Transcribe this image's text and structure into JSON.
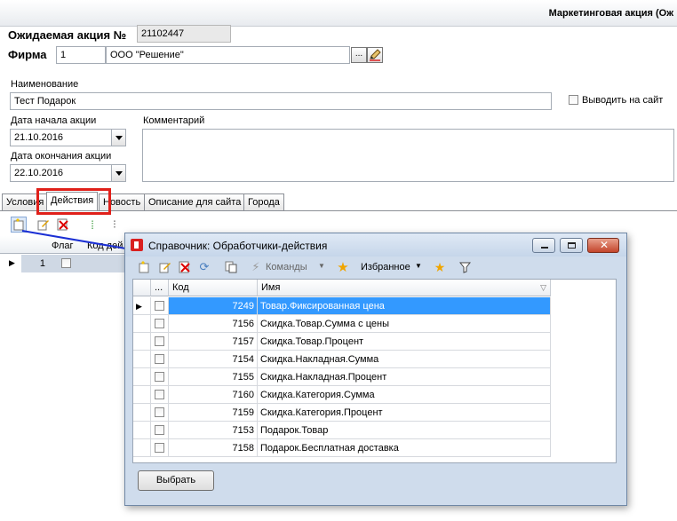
{
  "window": {
    "title": "Маркетинговая акция (Ож"
  },
  "header": {
    "promo_label": "Ожидаемая акция №",
    "promo_number": "21102447",
    "firm_label": "Фирма",
    "firm_code": "1",
    "firm_name": "ООО \"Решение\"",
    "firm_pick": "...",
    "firm_edit_icon": "pencil-icon"
  },
  "form": {
    "name_label": "Наименование",
    "name_value": "Тест Подарок",
    "show_on_site_label": "Выводить на сайт",
    "start_date_label": "Дата начала акции",
    "start_date": "21.10.2016",
    "end_date_label": "Дата окончания акции",
    "end_date": "22.10.2016",
    "comment_label": "Комментарий"
  },
  "tabs": [
    "Условия",
    "Действия",
    "Новость",
    "Описание для сайта",
    "Города"
  ],
  "active_tab": "Действия",
  "highlight_color": "#e0201a",
  "back_grid": {
    "columns": [
      "Флаг",
      "Код дей"
    ],
    "rows": [
      {
        "num": "1"
      }
    ]
  },
  "dialog": {
    "title": "Справочник: Обработчики-действия",
    "toolbar": {
      "commands": "Команды",
      "favorites": "Избранное"
    },
    "columns": {
      "dots": "...",
      "code": "Код",
      "name": "Имя"
    },
    "rows": [
      {
        "code": "7249",
        "name": "Товар.Фиксированная цена"
      },
      {
        "code": "7156",
        "name": "Скидка.Товар.Сумма с цены"
      },
      {
        "code": "7157",
        "name": "Скидка.Товар.Процент"
      },
      {
        "code": "7154",
        "name": "Скидка.Накладная.Сумма"
      },
      {
        "code": "7155",
        "name": "Скидка.Накладная.Процент"
      },
      {
        "code": "7160",
        "name": "Скидка.Категория.Сумма"
      },
      {
        "code": "7159",
        "name": "Скидка.Категория.Процент"
      },
      {
        "code": "7153",
        "name": "Подарок.Товар"
      },
      {
        "code": "7158",
        "name": "Подарок.Бесплатная доставка"
      }
    ],
    "select_button": "Выбрать",
    "selection_color": "#3399ff"
  }
}
